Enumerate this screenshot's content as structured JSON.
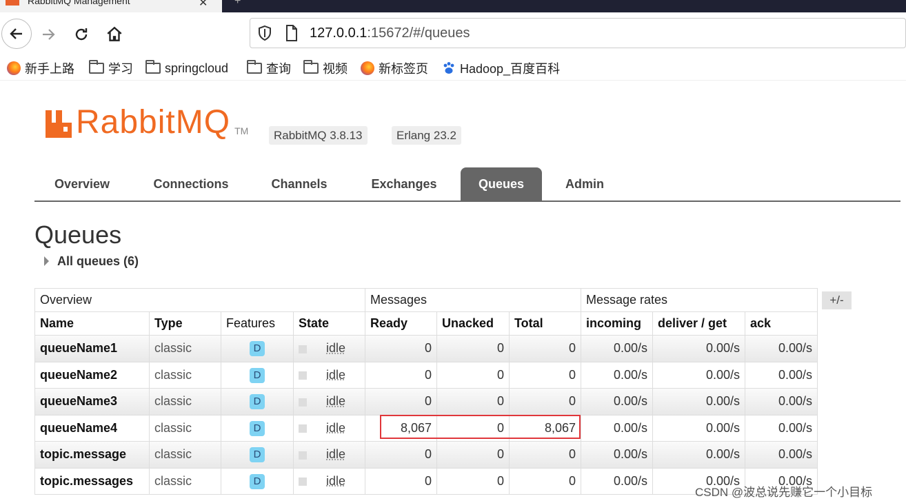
{
  "browser": {
    "tab_title": "RabbitMQ Management",
    "tab_close": "✕",
    "new_tab": "+",
    "url_host": "127.0.0.1",
    "url_rest": ":15672/#/queues",
    "bookmarks": [
      "新手上路",
      "学习",
      "springcloud",
      "查询",
      "视频",
      "新标签页",
      "Hadoop_百度百科"
    ]
  },
  "header": {
    "logo_text": "RabbitMQ",
    "logo_tm": "TM",
    "version": "RabbitMQ 3.8.13",
    "erlang": "Erlang 23.2"
  },
  "nav": {
    "tabs": [
      "Overview",
      "Connections",
      "Channels",
      "Exchanges",
      "Queues",
      "Admin"
    ],
    "active": "Queues"
  },
  "page": {
    "title": "Queues",
    "all_queues": "All queues (6)"
  },
  "table": {
    "groups": [
      "Overview",
      "Messages",
      "Message rates"
    ],
    "columns": [
      "Name",
      "Type",
      "Features",
      "State",
      "Ready",
      "Unacked",
      "Total",
      "incoming",
      "deliver / get",
      "ack"
    ],
    "toggle_label": "+/-",
    "rows": [
      {
        "name": "queueName1",
        "type": "classic",
        "feature": "D",
        "state": "idle",
        "ready": "0",
        "unacked": "0",
        "total": "0",
        "incoming": "0.00/s",
        "deliver": "0.00/s",
        "ack": "0.00/s"
      },
      {
        "name": "queueName2",
        "type": "classic",
        "feature": "D",
        "state": "idle",
        "ready": "0",
        "unacked": "0",
        "total": "0",
        "incoming": "0.00/s",
        "deliver": "0.00/s",
        "ack": "0.00/s"
      },
      {
        "name": "queueName3",
        "type": "classic",
        "feature": "D",
        "state": "idle",
        "ready": "0",
        "unacked": "0",
        "total": "0",
        "incoming": "0.00/s",
        "deliver": "0.00/s",
        "ack": "0.00/s"
      },
      {
        "name": "queueName4",
        "type": "classic",
        "feature": "D",
        "state": "idle",
        "ready": "8,067",
        "unacked": "0",
        "total": "8,067",
        "incoming": "0.00/s",
        "deliver": "0.00/s",
        "ack": "0.00/s"
      },
      {
        "name": "topic.message",
        "type": "classic",
        "feature": "D",
        "state": "idle",
        "ready": "0",
        "unacked": "0",
        "total": "0",
        "incoming": "0.00/s",
        "deliver": "0.00/s",
        "ack": "0.00/s"
      },
      {
        "name": "topic.messages",
        "type": "classic",
        "feature": "D",
        "state": "idle",
        "ready": "0",
        "unacked": "0",
        "total": "0",
        "incoming": "0.00/s",
        "deliver": "0.00/s",
        "ack": "0.00/s"
      }
    ]
  },
  "watermark": "CSDN @波总说先赚它一个小目标",
  "colors": {
    "brand": "#f06a22",
    "nav_active": "#666666",
    "highlight": "#e0363a",
    "feature_badge": "#7fd3f3"
  }
}
